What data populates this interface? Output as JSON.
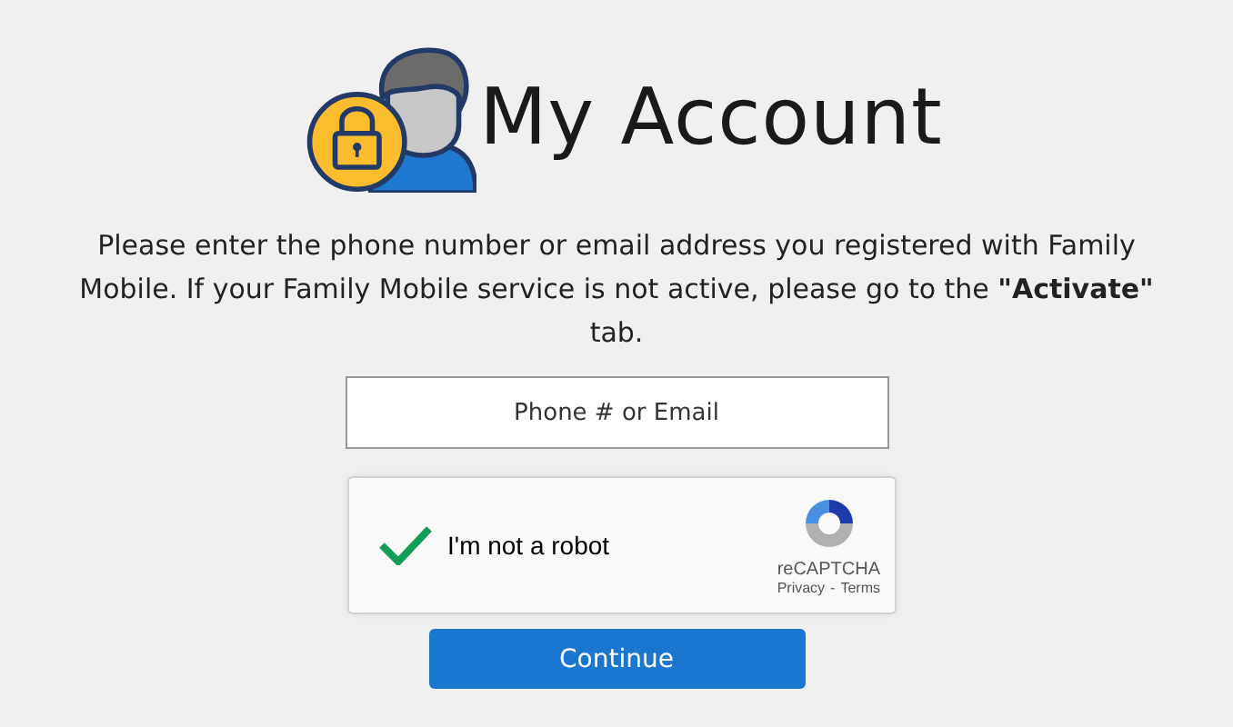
{
  "header": {
    "title": "My Account"
  },
  "instructions": "Please enter the phone number or email address you registered with Family Mobile. If your Family Mobile service is not active, please go to the **\"Activate\"** tab.",
  "login_field": {
    "placeholder": "Phone # or Email"
  },
  "captcha": {
    "label": "I'm not a robot",
    "checked": true,
    "brand": "reCAPTCHA",
    "privacy": "Privacy",
    "separator": "-",
    "terms": "Terms"
  },
  "buttons": [
    {
      "label": "Continue"
    }
  ]
}
